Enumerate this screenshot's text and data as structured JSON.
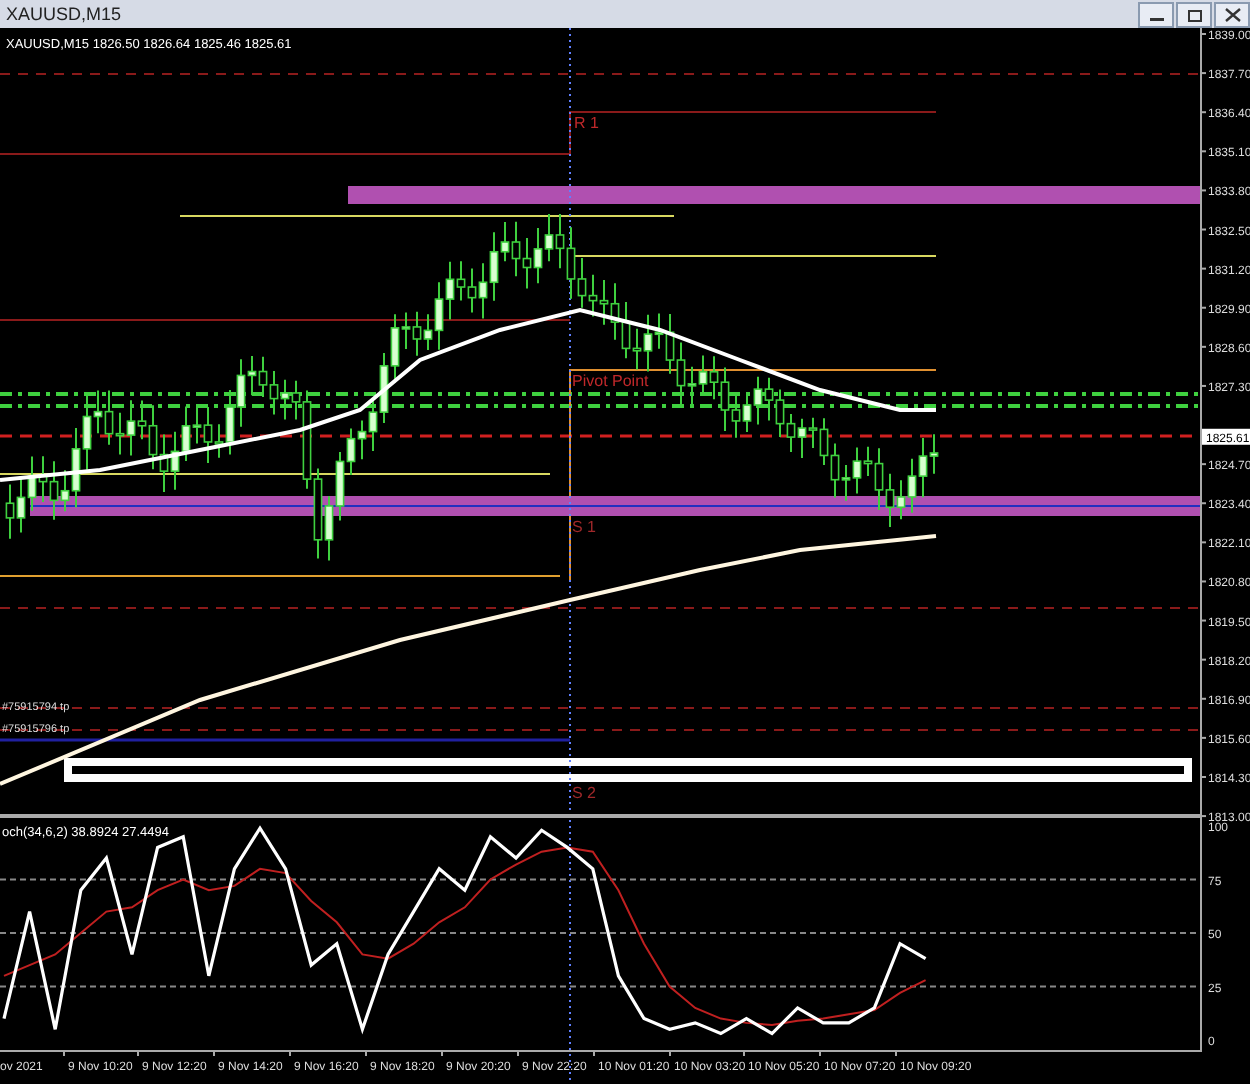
{
  "window": {
    "title": "XAUUSD,M15"
  },
  "chart": {
    "info": "XAUUSD,M15  1826.50 1826.64 1825.46 1825.61",
    "level_labels": [
      {
        "kind": "resistance",
        "text": "R 1"
      },
      {
        "kind": "pivot",
        "text": "Pivot Point"
      },
      {
        "kind": "support",
        "text": "S 1"
      },
      {
        "kind": "support",
        "text": "S 2"
      }
    ],
    "order_labels": [
      "#75915794 tp",
      "#75915796 tp"
    ]
  },
  "price_axis": {
    "labels": [
      "1839.00",
      "1837.70",
      "1836.40",
      "1835.10",
      "1833.80",
      "1832.50",
      "1831.20",
      "1829.90",
      "1828.60",
      "1827.30",
      "1824.70",
      "1823.40",
      "1822.10",
      "1820.80",
      "1819.50",
      "1818.20",
      "1816.90",
      "1815.60",
      "1814.30",
      "1813.00"
    ],
    "current_price": "1825.61"
  },
  "stochastic": {
    "label": "och(34,6,2) 38.8924 27.4494",
    "axis_labels": [
      "100",
      "75",
      "50",
      "25",
      "0"
    ]
  },
  "time_axis": {
    "labels": [
      "ov 2021",
      "9 Nov 10:20",
      "9 Nov 12:20",
      "9 Nov 14:20",
      "9 Nov 16:20",
      "9 Nov 18:20",
      "9 Nov 20:20",
      "9 Nov 22:20",
      "10 Nov 01:20",
      "10 Nov 03:20",
      "10 Nov 05:20",
      "10 Nov 07:20",
      "10 Nov 09:20"
    ]
  }
}
